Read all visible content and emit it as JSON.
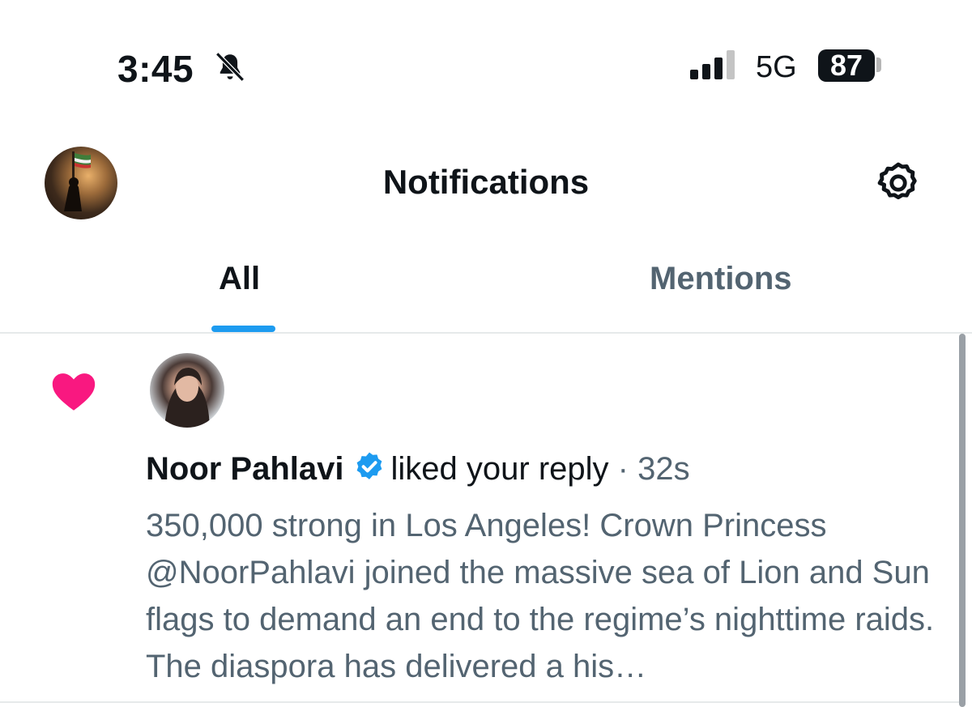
{
  "status_bar": {
    "time": "3:45",
    "network": "5G",
    "battery": "87",
    "icons": [
      "bell-slash-icon",
      "signal-icon"
    ]
  },
  "header": {
    "title": "Notifications",
    "icons": [
      "avatar",
      "gear-icon"
    ]
  },
  "tabs": [
    {
      "label": "All",
      "active": true
    },
    {
      "label": "Mentions",
      "active": false
    }
  ],
  "notification": {
    "type_icon": "heart-icon",
    "actor_name": "Noor Pahlavi",
    "verified_icon": "verified-badge-icon",
    "action": "liked your reply",
    "separator": "·",
    "time": "32s",
    "text": "350,000 strong in Los Angeles! Crown Princess @NoorPahlavi joined the massive sea of Lion and Sun flags to demand an end to the regime’s nighttime raids. The diaspora has delivered a his…"
  },
  "colors": {
    "accent": "#1d9bf0",
    "heart": "#f91880",
    "secondary_text": "#536471",
    "primary_text": "#0f1419"
  }
}
